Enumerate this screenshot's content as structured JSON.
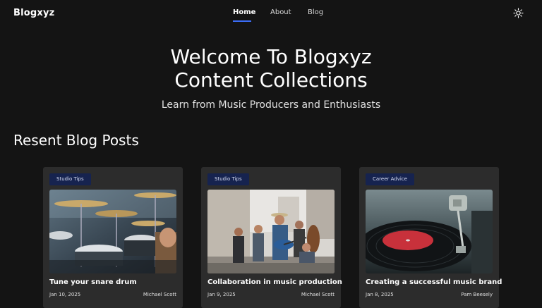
{
  "nav": {
    "brand": "Blogxyz",
    "links": [
      {
        "label": "Home",
        "active": true
      },
      {
        "label": "About",
        "active": false
      },
      {
        "label": "Blog",
        "active": false
      }
    ],
    "theme_icon": "sun-icon",
    "accent": "#3b6cf6"
  },
  "hero": {
    "title_line1": "Welcome To Blogxyz",
    "title_line2": "Content Collections",
    "subtitle": "Learn from Music Producers and Enthusiasts"
  },
  "section": {
    "title": "Resent Blog Posts"
  },
  "posts": [
    {
      "category": "Studio Tips",
      "title": "Tune your snare drum",
      "date": "Jan 10, 2025",
      "author": "Michael Scott",
      "image": "drum-kit-photo"
    },
    {
      "category": "Studio Tips",
      "title": "Collaboration in music production",
      "date": "Jan 9, 2025",
      "author": "Michael Scott",
      "image": "street-band-photo"
    },
    {
      "category": "Career Advice",
      "title": "Creating a successful music brand",
      "date": "Jan 8, 2025",
      "author": "Pam Beesely",
      "image": "vinyl-record-photo"
    }
  ],
  "colors": {
    "background": "#141414",
    "card": "#2c2c2c",
    "badge": "#16234f"
  }
}
